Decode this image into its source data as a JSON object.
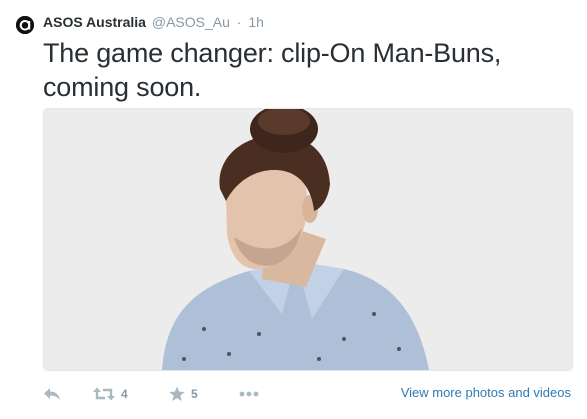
{
  "tweet": {
    "author": {
      "name": "ASOS Australia",
      "handle": "@ASOS_Au"
    },
    "separator": "·",
    "timestamp": "1h",
    "text_line1": "The game changer: clip-On Man-Buns,",
    "text_line2": "coming soon.",
    "media": {
      "icon": "photo"
    }
  },
  "actions": {
    "reply_icon": "reply-icon",
    "retweet_icon": "retweet-icon",
    "retweet_count": "4",
    "favorite_icon": "star-icon",
    "favorite_count": "5",
    "more_icon": "more-icon",
    "view_more_label": "View more photos and videos"
  },
  "colors": {
    "link": "#2b7bb9",
    "muted": "#8899a6",
    "icon": "#aab8c2",
    "text": "#292f33"
  }
}
